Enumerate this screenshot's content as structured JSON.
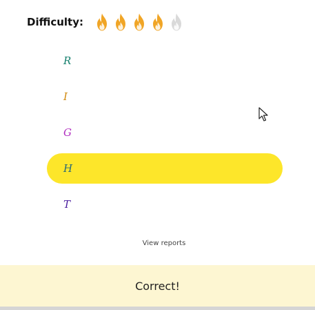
{
  "difficulty": {
    "label": "Difficulty:",
    "level": 4,
    "max": 5,
    "active_color": "#f0a526",
    "inactive_color": "#d9d9d9"
  },
  "options": [
    {
      "letter": "R",
      "color": "#16806e",
      "selected": false
    },
    {
      "letter": "I",
      "color": "#d18a10",
      "selected": false
    },
    {
      "letter": "G",
      "color": "#b02bbf",
      "selected": false
    },
    {
      "letter": "H",
      "color": "#2a6a78",
      "selected": true
    },
    {
      "letter": "T",
      "color": "#4a1e9e",
      "selected": false
    }
  ],
  "selected_color": "#fde62a",
  "view_reports_label": "View reports",
  "result": {
    "text": "Correct!",
    "background": "#fdf6d2"
  },
  "icons": {
    "flame": "flame-icon",
    "cursor": "mouse-cursor-icon"
  }
}
